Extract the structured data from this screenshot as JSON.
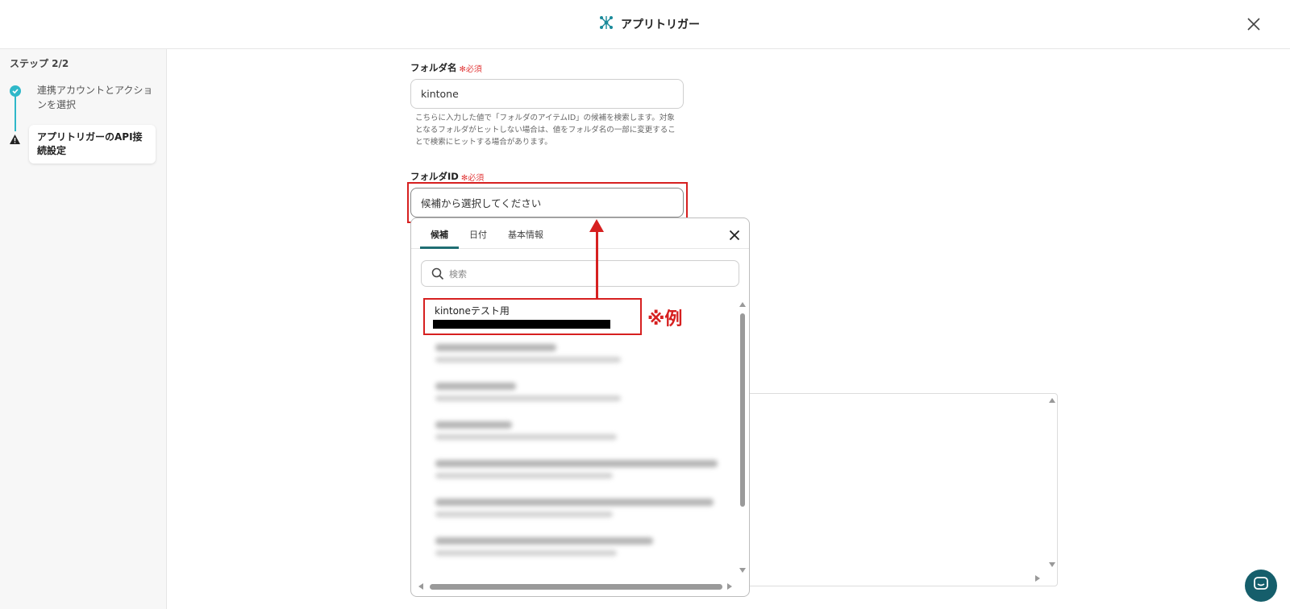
{
  "header": {
    "title": "アプリトリガー",
    "logo_icon": "network-logo-icon",
    "close_icon": "close-icon"
  },
  "sidebar": {
    "step_label": "ステップ 2/2",
    "steps": [
      {
        "label": "連携アカウントとアクションを選択",
        "status": "completed",
        "icon": "check-circle-icon"
      },
      {
        "label": "アプリトリガーのAPI接続設定",
        "status": "warning",
        "icon": "warning-icon"
      }
    ]
  },
  "form": {
    "folder_name": {
      "label": "フォルダ名",
      "required": "必須",
      "value": "kintone",
      "help": "こちらに入力した値で「フォルダのアイテムID」の候補を検索します。対象となるフォルダがヒットしない場合は、値をフォルダ名の一部に変更することで検索にヒットする場合があります。"
    },
    "folder_id": {
      "label": "フォルダID",
      "required": "必須",
      "placeholder": "候補から選択してください"
    }
  },
  "dropdown": {
    "tabs": [
      {
        "label": "候補",
        "active": true
      },
      {
        "label": "日付",
        "active": false
      },
      {
        "label": "基本情報",
        "active": false
      }
    ],
    "search_placeholder": "検索",
    "first_option": "kintoneテスト用"
  },
  "annotation": {
    "text": "※例",
    "color": "#d62020"
  },
  "colors": {
    "accent": "#2fb8c9",
    "chat": "#155e6b",
    "annotation": "#d62020",
    "required": "#e23c3c"
  }
}
